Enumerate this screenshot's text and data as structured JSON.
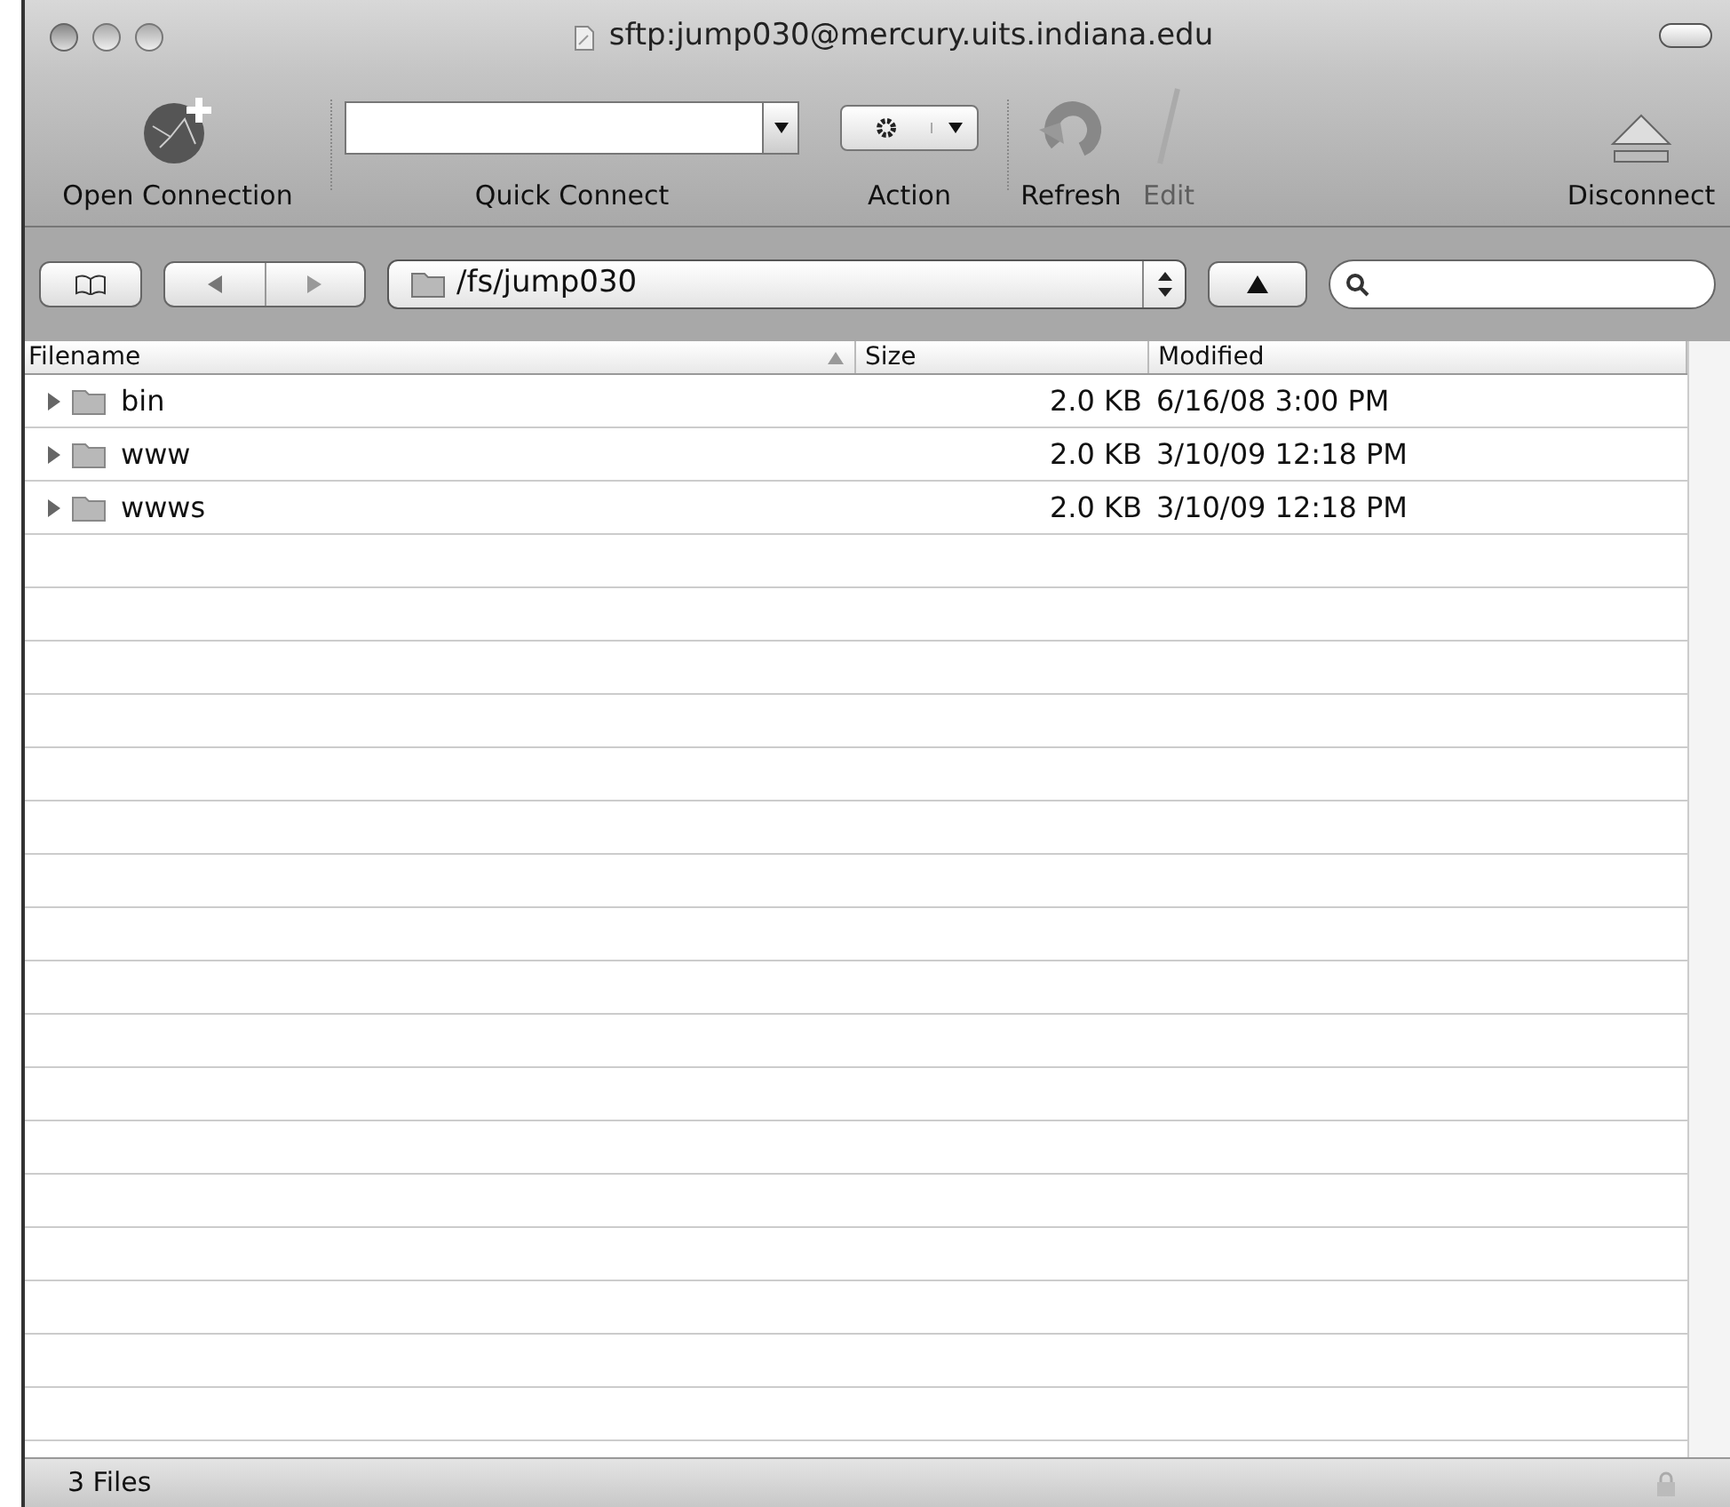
{
  "window": {
    "title": "sftp:jump030@mercury.uits.indiana.edu"
  },
  "toolbar": [
    {
      "kind": "open",
      "label": "Open Connection",
      "disabled": false
    },
    {
      "kind": "quick",
      "label": "Quick Connect",
      "disabled": false
    },
    {
      "kind": "action",
      "label": "Action",
      "disabled": false
    },
    {
      "kind": "refresh",
      "label": "Refresh",
      "disabled": false
    },
    {
      "kind": "edit",
      "label": "Edit",
      "disabled": true
    },
    {
      "kind": "disconnect",
      "label": "Disconnect",
      "disabled": false
    }
  ],
  "path": {
    "value": "/fs/jump030"
  },
  "table": {
    "columns": [
      {
        "label": "Filename",
        "sorted": true
      },
      {
        "label": "Size",
        "sorted": false
      },
      {
        "label": "Modified",
        "sorted": false
      }
    ],
    "rows": [
      {
        "name": "bin",
        "size": "2.0 KB",
        "modified": "6/16/08 3:00 PM",
        "expanded": false
      },
      {
        "name": "www",
        "size": "2.0 KB",
        "modified": "3/10/09 12:18 PM",
        "expanded": false
      },
      {
        "name": "wwws",
        "size": "2.0 KB",
        "modified": "3/10/09 12:18 PM",
        "expanded": false
      }
    ]
  },
  "status_bar": {
    "text": "3 Files"
  }
}
